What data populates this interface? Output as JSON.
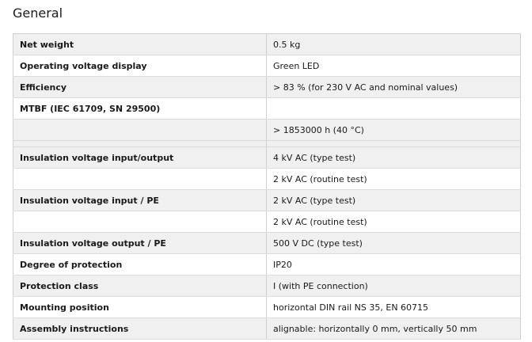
{
  "section": {
    "title": "General"
  },
  "rows": [
    {
      "label": "Net weight",
      "value": "0.5 kg"
    },
    {
      "label": "Operating voltage display",
      "value": "Green LED"
    },
    {
      "label": "Efficiency",
      "value": "> 83 % (for 230 V AC and nominal values)"
    },
    {
      "label": "MTBF (IEC 61709, SN 29500)",
      "value": ""
    },
    {
      "label": "",
      "value": "> 1853000 h (40 °C)"
    },
    {
      "label": "",
      "value": ""
    },
    {
      "label": "Insulation voltage input/output",
      "value": "4 kV AC (type test)"
    },
    {
      "label": "",
      "value": "2 kV AC (routine test)"
    },
    {
      "label": "Insulation voltage input / PE",
      "value": "2 kV AC (type test)"
    },
    {
      "label": "",
      "value": "2 kV AC (routine test)"
    },
    {
      "label": "Insulation voltage output / PE",
      "value": "500 V DC (type test)"
    },
    {
      "label": "Degree of protection",
      "value": "IP20"
    },
    {
      "label": "Protection class",
      "value": "I (with PE connection)"
    },
    {
      "label": "Mounting position",
      "value": "horizontal DIN rail NS 35, EN 60715"
    },
    {
      "label": "Assembly instructions",
      "value": "alignable: horizontally 0 mm, vertically 50 mm"
    }
  ]
}
